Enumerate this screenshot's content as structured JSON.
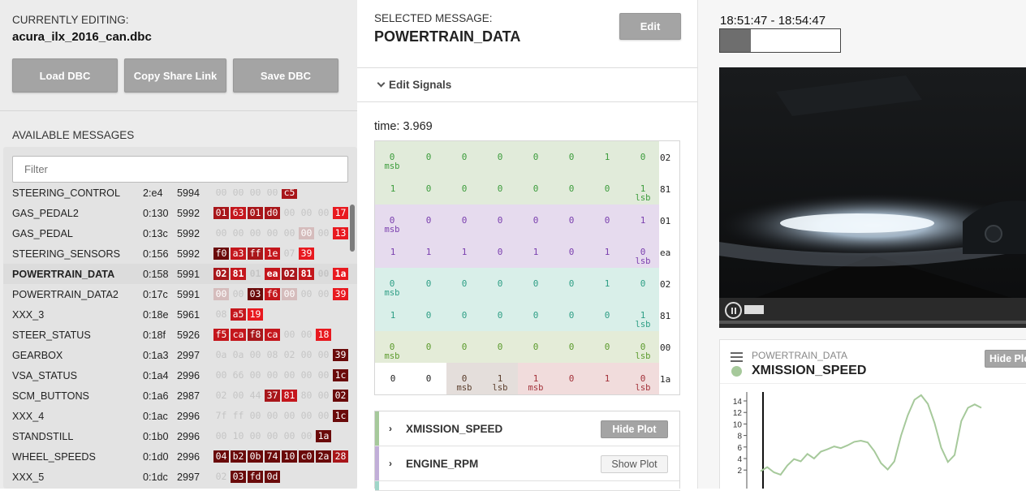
{
  "left": {
    "editing_label": "CURRENTLY EDITING:",
    "dbc_name": "acura_ilx_2016_can.dbc",
    "buttons": {
      "load": "Load DBC",
      "share": "Copy Share Link",
      "save": "Save DBC"
    },
    "available_label": "AVAILABLE MESSAGES",
    "filter_placeholder": "Filter",
    "messages": [
      {
        "name": "STEERING_CONTROL",
        "addr": "2:e4",
        "count": "5994",
        "bytes": [
          [
            "00",
            "e0"
          ],
          [
            "00",
            "e0"
          ],
          [
            "00",
            "e0"
          ],
          [
            "00",
            "e0"
          ],
          [
            "c5",
            "r1"
          ]
        ]
      },
      {
        "name": "GAS_PEDAL2",
        "addr": "0:130",
        "count": "5992",
        "bytes": [
          [
            "01",
            "r1"
          ],
          [
            "63",
            "r2"
          ],
          [
            "01",
            "r1"
          ],
          [
            "d0",
            "r1"
          ],
          [
            "00",
            "e0"
          ],
          [
            "00",
            "e0"
          ],
          [
            "00",
            "e0"
          ],
          [
            "17",
            "r3"
          ]
        ]
      },
      {
        "name": "GAS_PEDAL",
        "addr": "0:13c",
        "count": "5992",
        "bytes": [
          [
            "00",
            "e0"
          ],
          [
            "00",
            "e0"
          ],
          [
            "00",
            "e0"
          ],
          [
            "00",
            "e0"
          ],
          [
            "00",
            "e0"
          ],
          [
            "00",
            "e1"
          ],
          [
            "00",
            "e0"
          ],
          [
            "13",
            "r3"
          ]
        ]
      },
      {
        "name": "STEERING_SENSORS",
        "addr": "0:156",
        "count": "5992",
        "bytes": [
          [
            "f0",
            "d1"
          ],
          [
            "a3",
            "r2"
          ],
          [
            "ff",
            "r1"
          ],
          [
            "1e",
            "r2"
          ],
          [
            "07",
            "e0"
          ],
          [
            "39",
            "r3"
          ]
        ]
      },
      {
        "name": "POWERTRAIN_DATA",
        "addr": "0:158",
        "count": "5991",
        "bytes": [
          [
            "02",
            "r1"
          ],
          [
            "81",
            "r2"
          ],
          [
            "01",
            "e0"
          ],
          [
            "ea",
            "r2"
          ],
          [
            "02",
            "r1"
          ],
          [
            "81",
            "r2"
          ],
          [
            "00",
            "e0"
          ],
          [
            "1a",
            "r3"
          ]
        ]
      },
      {
        "name": "POWERTRAIN_DATA2",
        "addr": "0:17c",
        "count": "5991",
        "bytes": [
          [
            "00",
            "e1"
          ],
          [
            "00",
            "e0"
          ],
          [
            "03",
            "d1"
          ],
          [
            "f6",
            "r2"
          ],
          [
            "00",
            "e1"
          ],
          [
            "00",
            "e0"
          ],
          [
            "00",
            "e0"
          ],
          [
            "39",
            "r3"
          ]
        ]
      },
      {
        "name": "XXX_3",
        "addr": "0:18e",
        "count": "5961",
        "bytes": [
          [
            "08",
            "e0"
          ],
          [
            "a5",
            "r2"
          ],
          [
            "19",
            "r3"
          ]
        ]
      },
      {
        "name": "STEER_STATUS",
        "addr": "0:18f",
        "count": "5926",
        "bytes": [
          [
            "f5",
            "r2"
          ],
          [
            "ca",
            "r2"
          ],
          [
            "f8",
            "r1"
          ],
          [
            "ca",
            "r2"
          ],
          [
            "00",
            "e0"
          ],
          [
            "00",
            "e0"
          ],
          [
            "18",
            "r3"
          ]
        ]
      },
      {
        "name": "GEARBOX",
        "addr": "0:1a3",
        "count": "2997",
        "bytes": [
          [
            "0a",
            "e0"
          ],
          [
            "0a",
            "e0"
          ],
          [
            "00",
            "e0"
          ],
          [
            "08",
            "e0"
          ],
          [
            "02",
            "e0"
          ],
          [
            "00",
            "e0"
          ],
          [
            "00",
            "e0"
          ],
          [
            "39",
            "d1"
          ]
        ]
      },
      {
        "name": "VSA_STATUS",
        "addr": "0:1a4",
        "count": "2996",
        "bytes": [
          [
            "00",
            "e0"
          ],
          [
            "66",
            "e0"
          ],
          [
            "00",
            "e0"
          ],
          [
            "00",
            "e0"
          ],
          [
            "00",
            "e0"
          ],
          [
            "00",
            "e0"
          ],
          [
            "00",
            "e0"
          ],
          [
            "1c",
            "d1"
          ]
        ]
      },
      {
        "name": "SCM_BUTTONS",
        "addr": "0:1a6",
        "count": "2987",
        "bytes": [
          [
            "02",
            "e0"
          ],
          [
            "00",
            "e0"
          ],
          [
            "44",
            "e0"
          ],
          [
            "37",
            "r1"
          ],
          [
            "81",
            "r2"
          ],
          [
            "80",
            "e0"
          ],
          [
            "00",
            "e0"
          ],
          [
            "02",
            "d1"
          ]
        ]
      },
      {
        "name": "XXX_4",
        "addr": "0:1ac",
        "count": "2996",
        "bytes": [
          [
            "7f",
            "e0"
          ],
          [
            "ff",
            "e0"
          ],
          [
            "00",
            "e0"
          ],
          [
            "00",
            "e0"
          ],
          [
            "00",
            "e0"
          ],
          [
            "00",
            "e0"
          ],
          [
            "00",
            "e0"
          ],
          [
            "1c",
            "d1"
          ]
        ]
      },
      {
        "name": "STANDSTILL",
        "addr": "0:1b0",
        "count": "2996",
        "bytes": [
          [
            "00",
            "e0"
          ],
          [
            "10",
            "e0"
          ],
          [
            "00",
            "e0"
          ],
          [
            "00",
            "e0"
          ],
          [
            "00",
            "e0"
          ],
          [
            "00",
            "e0"
          ],
          [
            "1a",
            "d1"
          ]
        ]
      },
      {
        "name": "WHEEL_SPEEDS",
        "addr": "0:1d0",
        "count": "2996",
        "bytes": [
          [
            "04",
            "d1"
          ],
          [
            "b2",
            "d1"
          ],
          [
            "0b",
            "d1"
          ],
          [
            "74",
            "d1"
          ],
          [
            "10",
            "d1"
          ],
          [
            "c0",
            "d1"
          ],
          [
            "2a",
            "d1"
          ],
          [
            "28",
            "r1"
          ]
        ]
      },
      {
        "name": "XXX_5",
        "addr": "0:1dc",
        "count": "2997",
        "bytes": [
          [
            "02",
            "e0"
          ],
          [
            "03",
            "d1"
          ],
          [
            "fd",
            "d1"
          ],
          [
            "0d",
            "d1"
          ]
        ]
      }
    ]
  },
  "mid": {
    "selected_label": "SELECTED MESSAGE:",
    "message_name": "POWERTRAIN_DATA",
    "edit_button": "Edit",
    "edit_signals": "Edit Signals",
    "time_label": "time: 3.969",
    "bit_rows": [
      {
        "hex": "02",
        "bg": "#e1ebda",
        "color": "#3c9c3c",
        "bits": [
          "0",
          "0",
          "0",
          "0",
          "0",
          "0",
          "1",
          "0"
        ],
        "sub": [
          "msb",
          "",
          "",
          "",
          "",
          "",
          "",
          ""
        ]
      },
      {
        "hex": "81",
        "bg": "#e1ebda",
        "color": "#3c9c3c",
        "bits": [
          "1",
          "0",
          "0",
          "0",
          "0",
          "0",
          "0",
          "1"
        ],
        "sub": [
          "",
          "",
          "",
          "",
          "",
          "",
          "",
          "lsb"
        ]
      },
      {
        "hex": "01",
        "bg": "#e6dbee",
        "color": "#7a3fae",
        "bits": [
          "0",
          "0",
          "0",
          "0",
          "0",
          "0",
          "0",
          "1"
        ],
        "sub": [
          "msb",
          "",
          "",
          "",
          "",
          "",
          "",
          ""
        ]
      },
      {
        "hex": "ea",
        "bg": "#e6dbee",
        "color": "#7a3fae",
        "bits": [
          "1",
          "1",
          "1",
          "0",
          "1",
          "0",
          "1",
          "0"
        ],
        "sub": [
          "",
          "",
          "",
          "",
          "",
          "",
          "",
          "lsb"
        ]
      },
      {
        "hex": "02",
        "bg": "#d9efe9",
        "color": "#2e9e85",
        "bits": [
          "0",
          "0",
          "0",
          "0",
          "0",
          "0",
          "1",
          "0"
        ],
        "sub": [
          "msb",
          "",
          "",
          "",
          "",
          "",
          "",
          ""
        ]
      },
      {
        "hex": "81",
        "bg": "#d9efe9",
        "color": "#2e9e85",
        "bits": [
          "1",
          "0",
          "0",
          "0",
          "0",
          "0",
          "0",
          "1"
        ],
        "sub": [
          "",
          "",
          "",
          "",
          "",
          "",
          "",
          "lsb"
        ]
      },
      {
        "hex": "00",
        "bg": "#e4ecd8",
        "color": "#5b9a2d",
        "bits": [
          "0",
          "0",
          "0",
          "0",
          "0",
          "0",
          "0",
          "0"
        ],
        "sub": [
          "msb",
          "",
          "",
          "",
          "",
          "",
          "",
          "lsb"
        ]
      },
      {
        "hex": "1a",
        "bg": "mixed",
        "color": "#222",
        "bits": [
          "0",
          "0",
          "0",
          "1",
          "1",
          "0",
          "1",
          "0"
        ],
        "sub": [
          "",
          "",
          "msb",
          "lsb",
          "msb",
          "",
          "",
          "lsb"
        ]
      }
    ],
    "signals": [
      {
        "name": "XMISSION_SPEED",
        "button": "Hide Plot",
        "active": true,
        "color": "#a6c99b"
      },
      {
        "name": "ENGINE_RPM",
        "button": "Show Plot",
        "active": false,
        "color": "#c1aed8"
      }
    ]
  },
  "right": {
    "time_range": "18:51:47 - 18:54:47",
    "plot_message": "POWERTRAIN_DATA",
    "plot_signal": "XMISSION_SPEED",
    "hide_button": "Hide Plot",
    "y_ticks": [
      "14",
      "12",
      "10",
      "8",
      "6",
      "4",
      "2"
    ]
  },
  "chart_data": {
    "type": "line",
    "title": "",
    "series": [
      {
        "name": "XMISSION_SPEED",
        "values": [
          1.8,
          2.5,
          1.6,
          1.2,
          2.8,
          3.9,
          3.5,
          4.8,
          4.0,
          5.2,
          5.6,
          6.1,
          5.8,
          6.3,
          6.9,
          7.1,
          6.8,
          5.3,
          3.2,
          2.1,
          3.5,
          8.0,
          11.5,
          14.2,
          15.0,
          13.5,
          10.2,
          5.9,
          3.4,
          4.6,
          10.5,
          12.8,
          13.4,
          12.8
        ]
      }
    ],
    "ylim": [
      0,
      15
    ],
    "yticks": [
      2,
      4,
      6,
      8,
      10,
      12,
      14
    ],
    "color": "#a6c99b"
  }
}
